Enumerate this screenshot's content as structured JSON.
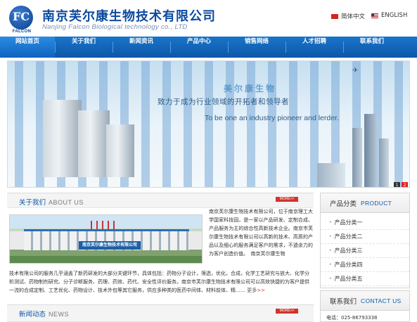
{
  "header": {
    "logo_letters": "FC",
    "logo_word": "FALCON",
    "company_cn": "南京芙尔康生物技术有限公司",
    "company_en": "Nanjing Falcon Biological technology co., LTD",
    "lang_cn": "简体中文",
    "lang_en": "ENGLISH"
  },
  "nav": {
    "items": [
      {
        "label": "网站首页"
      },
      {
        "label": "关于我们"
      },
      {
        "label": "新闻资讯"
      },
      {
        "label": "产品中心"
      },
      {
        "label": "销售网络"
      },
      {
        "label": "人才招聘"
      },
      {
        "label": "联系我们"
      }
    ]
  },
  "banner": {
    "slogan_cn": "致力于成为行业领域的开拓者和领导者",
    "slogan_en": "To be one an industry pioneer and lerder.",
    "relief_text": "美尔康生物",
    "controls": [
      "1",
      "2"
    ]
  },
  "about": {
    "title_cn": "关于我们",
    "title_en": "ABOUT US",
    "more": "MORE>>",
    "image_sign": "南京芙尔康生物技术有限公司",
    "text_right": "南京芙尔康生物技术有限公司，位于南京理工大学国家科技园，是一家以产品研发、定制合成、产品服务为主的综合性高新技术企业。南京市芙尔康生物技术有限公司以高新的技术、高质的产品以及细心的服务满足客户的需求，不遗余力的为客户创造价值。　南京芙尔康生物",
    "text_bottom": "技术有限公司的服务几乎涵盖了新药研发的大部分关键环节，具体包括：药物分子设计，筛选，优化，合成，化学工艺研究与放大、化学分析测试、药物制剂研究、分子诊断服务、药理、药效、药代、安全性评价服务。南京市芙尔康生物技术有限公司可以高效快捷的为客户提供一流的合成定制、工艺优化、药物设计、技术外包等其它服务，供应多种类的医药中间体、材料前体、精……",
    "more_text": "更多",
    "more_arrow": ">>"
  },
  "news": {
    "title_cn": "新闻动态",
    "title_en": "NEWS",
    "more": "MORE>>"
  },
  "sidebar": {
    "products": {
      "title_cn": "产品分类",
      "title_en": "PRODUCT",
      "items": [
        {
          "label": "产品分类一"
        },
        {
          "label": "产品分类二"
        },
        {
          "label": "产品分类三"
        },
        {
          "label": "产品分类四"
        },
        {
          "label": "产品分类五"
        }
      ]
    },
    "contact": {
      "title_cn": "联系我们",
      "title_en": "CONTACT US",
      "phone": "电话：025-86793338"
    }
  },
  "colors": {
    "brand_blue": "#0b4a9e",
    "nav_blue": "#1a74c9",
    "more_red": "#d3322d"
  }
}
